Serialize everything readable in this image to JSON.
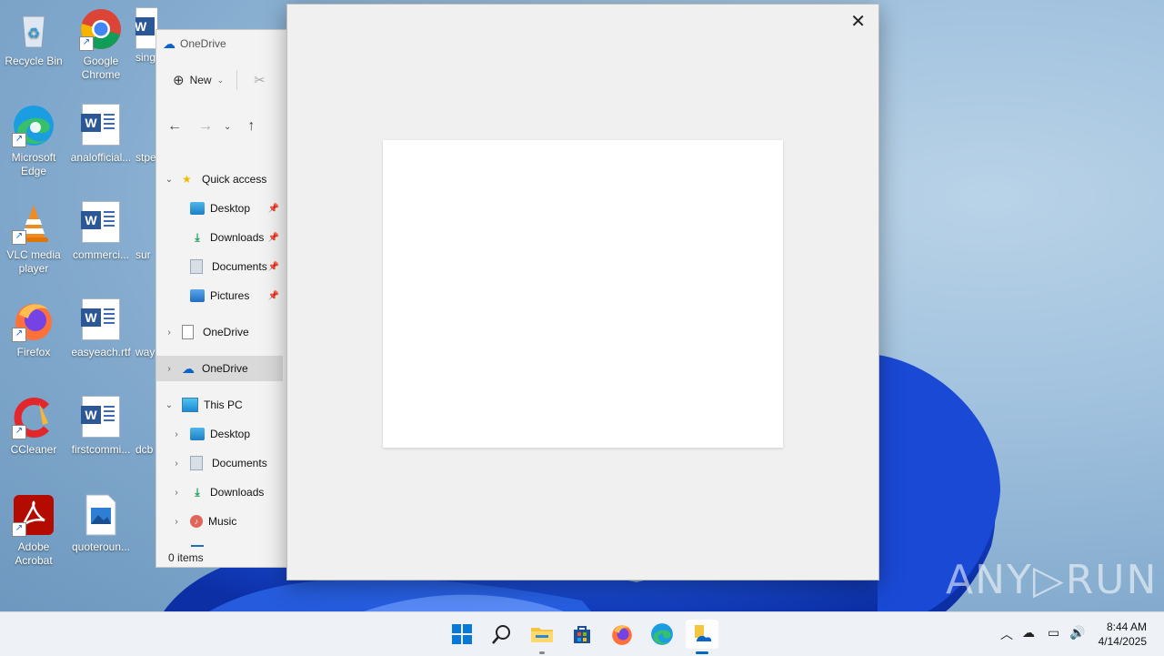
{
  "desktop": {
    "icons": [
      {
        "label": "Recycle Bin"
      },
      {
        "label": "Google Chrome"
      },
      {
        "label": "sing"
      },
      {
        "label": "Microsoft Edge"
      },
      {
        "label": "analofficial..."
      },
      {
        "label": "stpe"
      },
      {
        "label": "VLC media player"
      },
      {
        "label": "commerci..."
      },
      {
        "label": "sur"
      },
      {
        "label": "Firefox"
      },
      {
        "label": "easyeach.rtf"
      },
      {
        "label": "way"
      },
      {
        "label": "CCleaner"
      },
      {
        "label": "firstcommi..."
      },
      {
        "label": "dcb"
      },
      {
        "label": "Adobe Acrobat"
      },
      {
        "label": "quoteroun..."
      }
    ]
  },
  "explorer": {
    "title": "OneDrive",
    "toolbar": {
      "new_label": "New"
    },
    "tree": [
      {
        "label": "Quick access"
      },
      {
        "label": "Desktop"
      },
      {
        "label": "Downloads"
      },
      {
        "label": "Documents"
      },
      {
        "label": "Pictures"
      },
      {
        "label": "OneDrive"
      },
      {
        "label": "OneDrive"
      },
      {
        "label": "This PC"
      },
      {
        "label": "Desktop"
      },
      {
        "label": "Documents"
      },
      {
        "label": "Downloads"
      },
      {
        "label": "Music"
      }
    ],
    "status": "0 items"
  },
  "dialog": {
    "close_glyph": "✕"
  },
  "watermark": "ANY▷RUN",
  "taskbar": {
    "apps": [
      "start-button",
      "search-button",
      "file-explorer-button",
      "store-button",
      "firefox-button",
      "edge-button",
      "onedrive-setup-button"
    ],
    "clock": {
      "time": "8:44 AM",
      "date": "4/14/2025"
    }
  },
  "colors": {
    "accent": "#0067c0",
    "bloom": "#1a4fd8"
  }
}
